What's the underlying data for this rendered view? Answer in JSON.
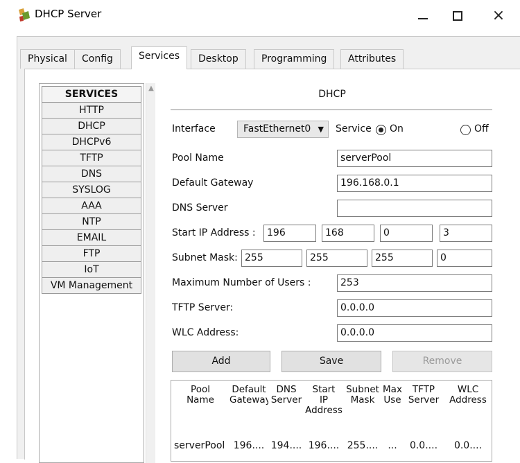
{
  "window": {
    "title": "DHCP Server",
    "minimize_label": "",
    "maximize_label": "",
    "close_label": "×"
  },
  "tabs": [
    {
      "label": "Physical",
      "active": false
    },
    {
      "label": "Config",
      "active": false
    },
    {
      "label": "Services",
      "active": true
    },
    {
      "label": "Desktop",
      "active": false
    },
    {
      "label": "Programming",
      "active": false
    },
    {
      "label": "Attributes",
      "active": false
    }
  ],
  "services": {
    "header": "SERVICES",
    "items": [
      "HTTP",
      "DHCP",
      "DHCPv6",
      "TFTP",
      "DNS",
      "SYSLOG",
      "AAA",
      "NTP",
      "EMAIL",
      "FTP",
      "IoT",
      "VM Management"
    ]
  },
  "dhcp": {
    "title": "DHCP",
    "interface_label": "Interface",
    "interface_value": "FastEthernet0",
    "service_label": "Service",
    "on_label": "On",
    "off_label": "Off",
    "service_on": true,
    "pool_name_label": "Pool Name",
    "pool_name_value": "serverPool",
    "default_gateway_label": "Default Gateway",
    "default_gateway_value": "196.168.0.1",
    "dns_server_label": "DNS Server",
    "dns_server_value": "",
    "start_ip_label": "Start IP Address :",
    "start_ip": [
      "196",
      "168",
      "0",
      "3"
    ],
    "subnet_mask_label": "Subnet Mask:",
    "subnet_mask": [
      "255",
      "255",
      "255",
      "0"
    ],
    "max_users_label": "Maximum Number of Users :",
    "max_users_value": "253",
    "tftp_server_label": "TFTP Server:",
    "tftp_server_value": "0.0.0.0",
    "wlc_address_label": "WLC Address:",
    "wlc_address_value": "0.0.0.0",
    "add_label": "Add",
    "save_label": "Save",
    "remove_label": "Remove"
  },
  "pool_table": {
    "headers": [
      "Pool\nName",
      "Default\nGateway",
      "DNS\nServer",
      "Start\nIP\nAddress",
      "Subnet\nMask",
      "Max\nUse",
      "TFTP\nServer",
      "WLC\nAddress"
    ],
    "rows": [
      [
        "serverPool",
        "196....",
        "194....",
        "196....",
        "255....",
        "...",
        "0.0....",
        "0.0...."
      ]
    ]
  },
  "colors": {
    "frame_bg": "#f0f0f0",
    "border": "#c8c8c8",
    "disabled_text": "#9a9a9a"
  }
}
